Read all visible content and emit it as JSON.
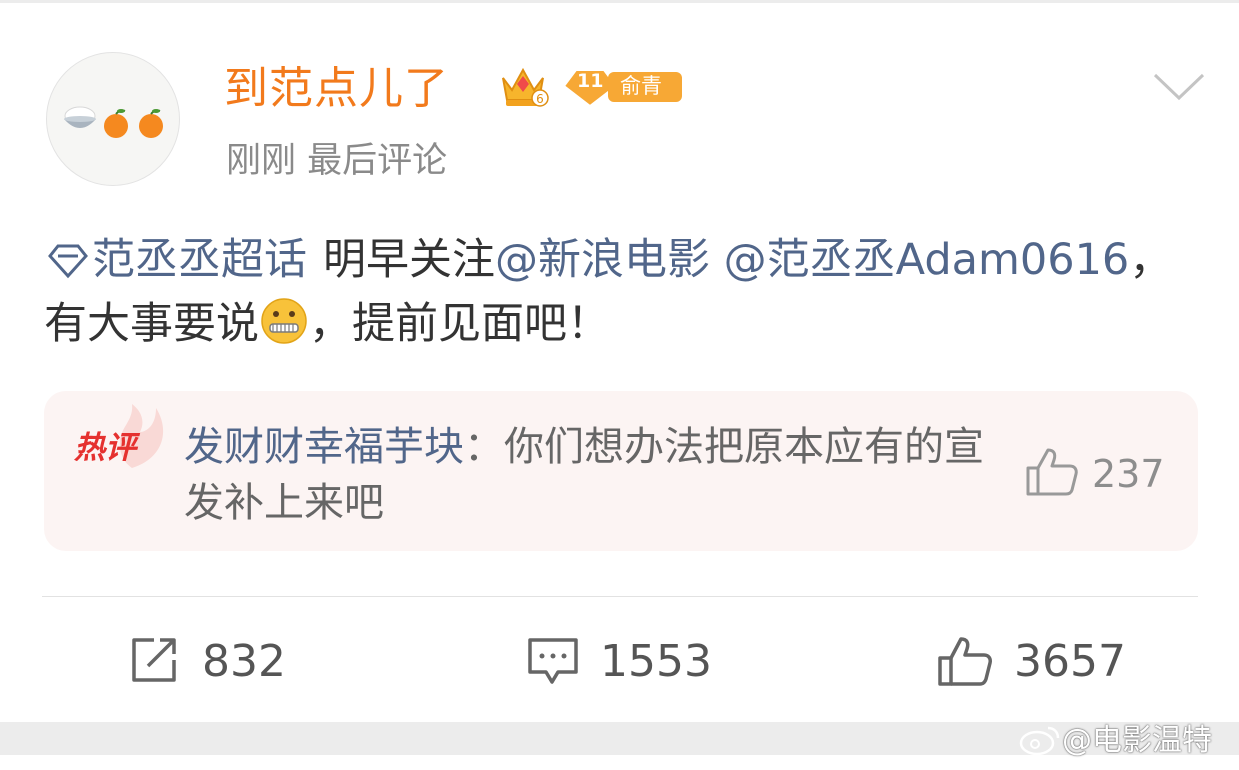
{
  "post": {
    "username": "到范点儿了",
    "level_number": "11",
    "level_tag": "俞青",
    "timestamp": "刚刚 最后评论",
    "text": {
      "topic": "范丞丞超话",
      "part1": "明早关注",
      "mention1": "@新浪电影",
      "mention2": "@范丞丞Adam0616",
      "part2": "，有大事要说",
      "part3": "，提前见面吧！"
    }
  },
  "hot_comment": {
    "badge": "热评",
    "author": "发财财幸福芋块",
    "separator": "：",
    "text": "你们想办法把原本应有的宣发补上来吧",
    "likes": "237"
  },
  "actions": {
    "repost_count": "832",
    "comment_count": "1553",
    "like_count": "3657"
  },
  "watermark": "@电影温特",
  "colors": {
    "username": "#f27a1c",
    "link": "#51668a",
    "hot_badge": "#e5312f",
    "hot_card_bg": "#fcf4f3"
  },
  "icons": {
    "avatar": "rice-bowl-and-oranges",
    "crown": "crown-icon",
    "level": "diamond-level-badge",
    "topic": "diamond-topic-icon",
    "emoji": "zipper-mouth-face-emoji",
    "collapse": "chevron-down-icon",
    "repost": "repost-icon",
    "comment": "comment-icon",
    "like": "thumbs-up-icon",
    "watermark_logo": "weibo-logo-icon"
  }
}
